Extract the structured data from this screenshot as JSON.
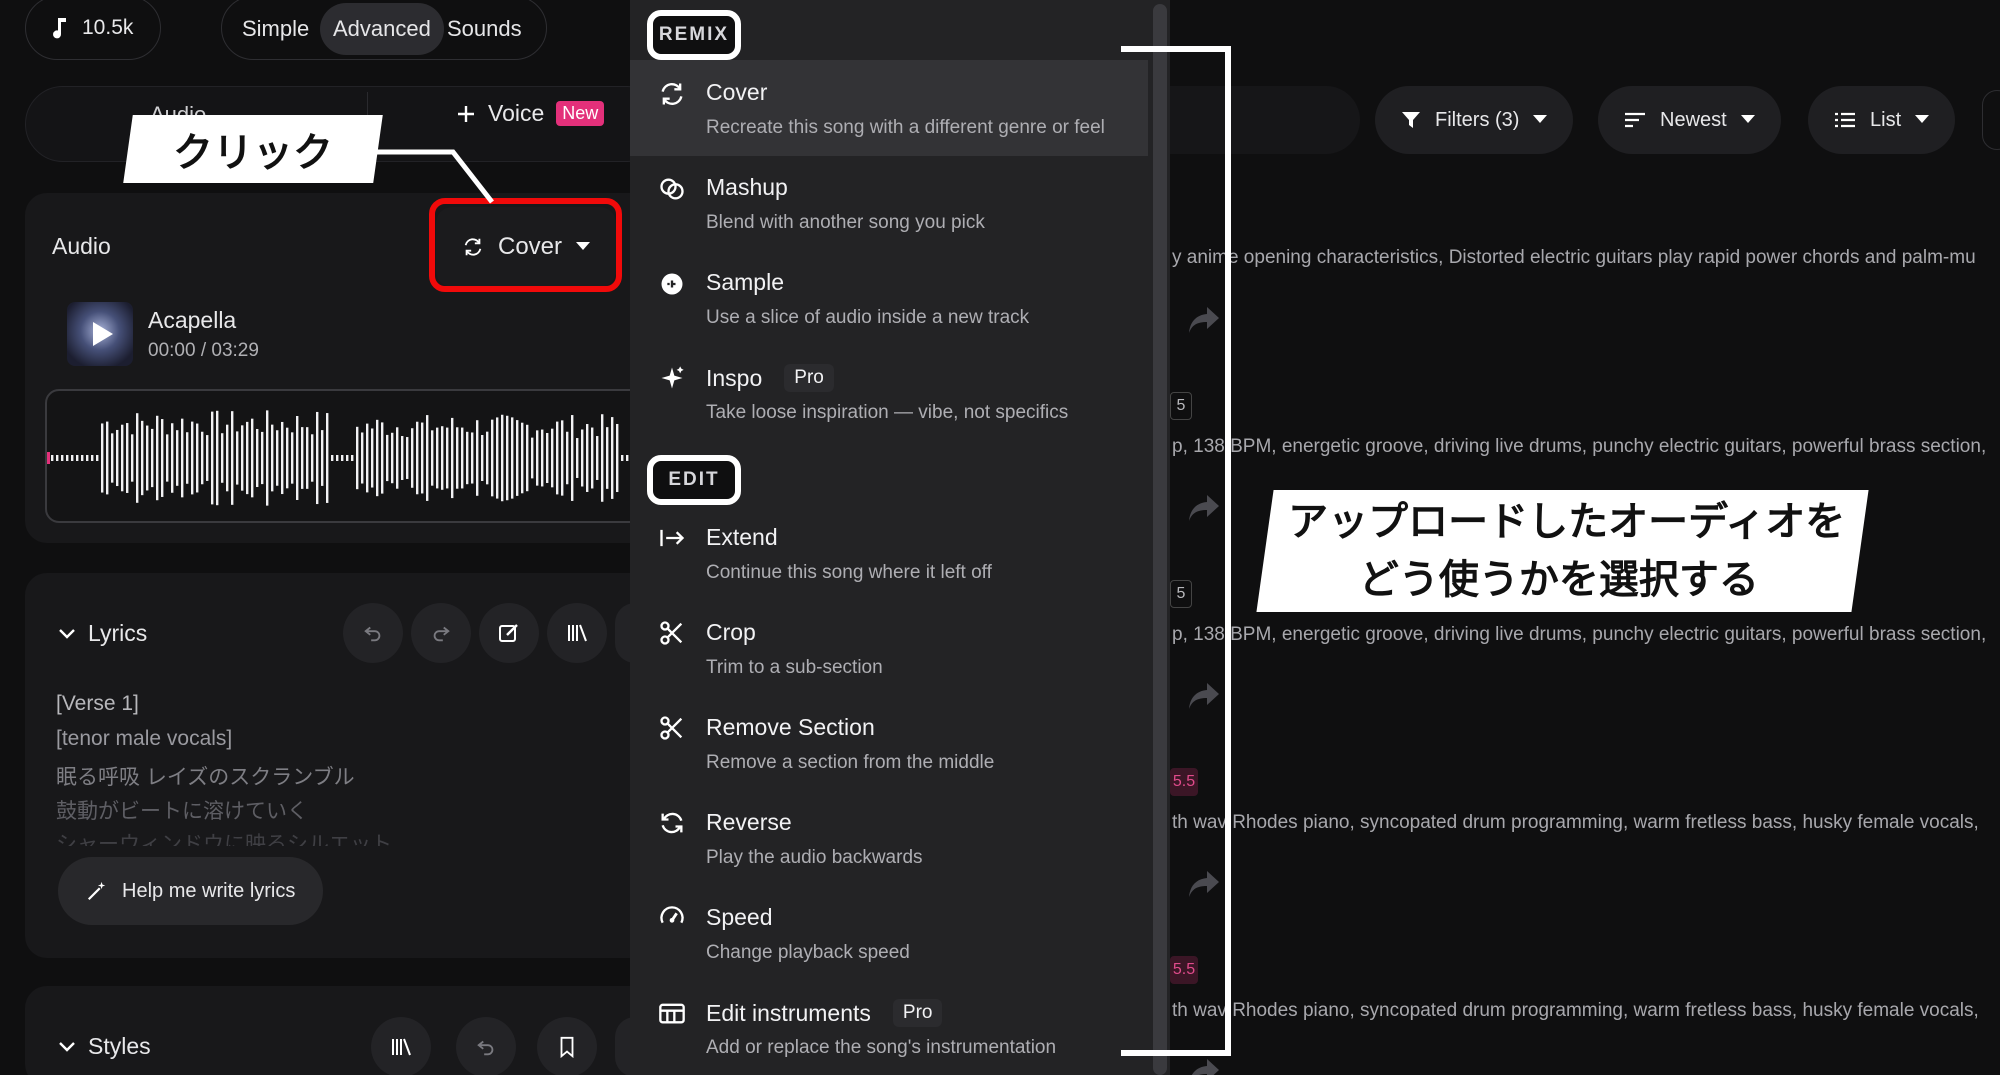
{
  "top": {
    "credits": "10.5k",
    "modes": [
      "Simple",
      "Advanced",
      "Sounds"
    ],
    "active_mode": "Advanced"
  },
  "create_tabs": {
    "audio": "Audio",
    "voice": "Voice",
    "voice_badge": "New"
  },
  "audio_card": {
    "title": "Audio",
    "mode_button": "Cover",
    "track": {
      "title": "Acapella",
      "time": "00:00 / 03:29"
    }
  },
  "lyrics_card": {
    "title": "Lyrics",
    "lines": [
      "[Verse 1]",
      "[tenor male vocals]",
      "眠る呼吸 レイズのスクランブル",
      "鼓動がビートに溶けていく",
      "シャーウィンドウに映るシルエット"
    ],
    "help_button": "Help me write lyrics"
  },
  "styles_card": {
    "title": "Styles"
  },
  "toolbar": {
    "filters": "Filters (3)",
    "sort": "Newest",
    "view": "List"
  },
  "feed": {
    "descriptions": [
      "y anime opening characteristics, Distorted electric guitars play rapid power chords and palm-mu",
      "p, 138 BPM, energetic groove, driving live drums, punchy electric guitars, powerful brass section,",
      "p, 138 BPM, energetic groove, driving live drums, punchy electric guitars, powerful brass section,",
      "th wav Rhodes piano, syncopated drum programming, warm fretless bass, husky female vocals,",
      "th wav Rhodes piano, syncopated drum programming, warm fretless bass, husky female vocals,"
    ],
    "tags": [
      "5",
      "5",
      "5.5",
      "5.5"
    ]
  },
  "menu": {
    "remix_label": "REMIX",
    "edit_label": "EDIT",
    "remix_items": [
      {
        "title": "Cover",
        "subtitle": "Recreate this song with a different genre or feel",
        "icon": "cover-icon"
      },
      {
        "title": "Mashup",
        "subtitle": "Blend with another song you pick",
        "icon": "mashup-icon"
      },
      {
        "title": "Sample",
        "subtitle": "Use a slice of audio inside a new track",
        "icon": "sample-icon"
      },
      {
        "title": "Inspo",
        "badge": "Pro",
        "subtitle": "Take loose inspiration — vibe, not specifics",
        "icon": "sparkle-icon"
      }
    ],
    "edit_items": [
      {
        "title": "Extend",
        "subtitle": "Continue this song where it left off",
        "icon": "extend-icon"
      },
      {
        "title": "Crop",
        "subtitle": "Trim to a sub-section",
        "icon": "scissors-icon"
      },
      {
        "title": "Remove Section",
        "subtitle": "Remove a section from the middle",
        "icon": "scissors-icon"
      },
      {
        "title": "Reverse",
        "subtitle": "Play the audio backwards",
        "icon": "reverse-icon"
      },
      {
        "title": "Speed",
        "subtitle": "Change playback speed",
        "icon": "speed-icon"
      },
      {
        "title": "Edit instruments",
        "badge": "Pro",
        "subtitle": "Add or replace the song's instrumentation",
        "icon": "instruments-icon"
      }
    ]
  },
  "annotations": {
    "click": "クリック",
    "callout_line1": "アップロードしたオーディオを",
    "callout_line2": "どう使うかを選択する",
    "highlight_color": "#f10a0a"
  }
}
